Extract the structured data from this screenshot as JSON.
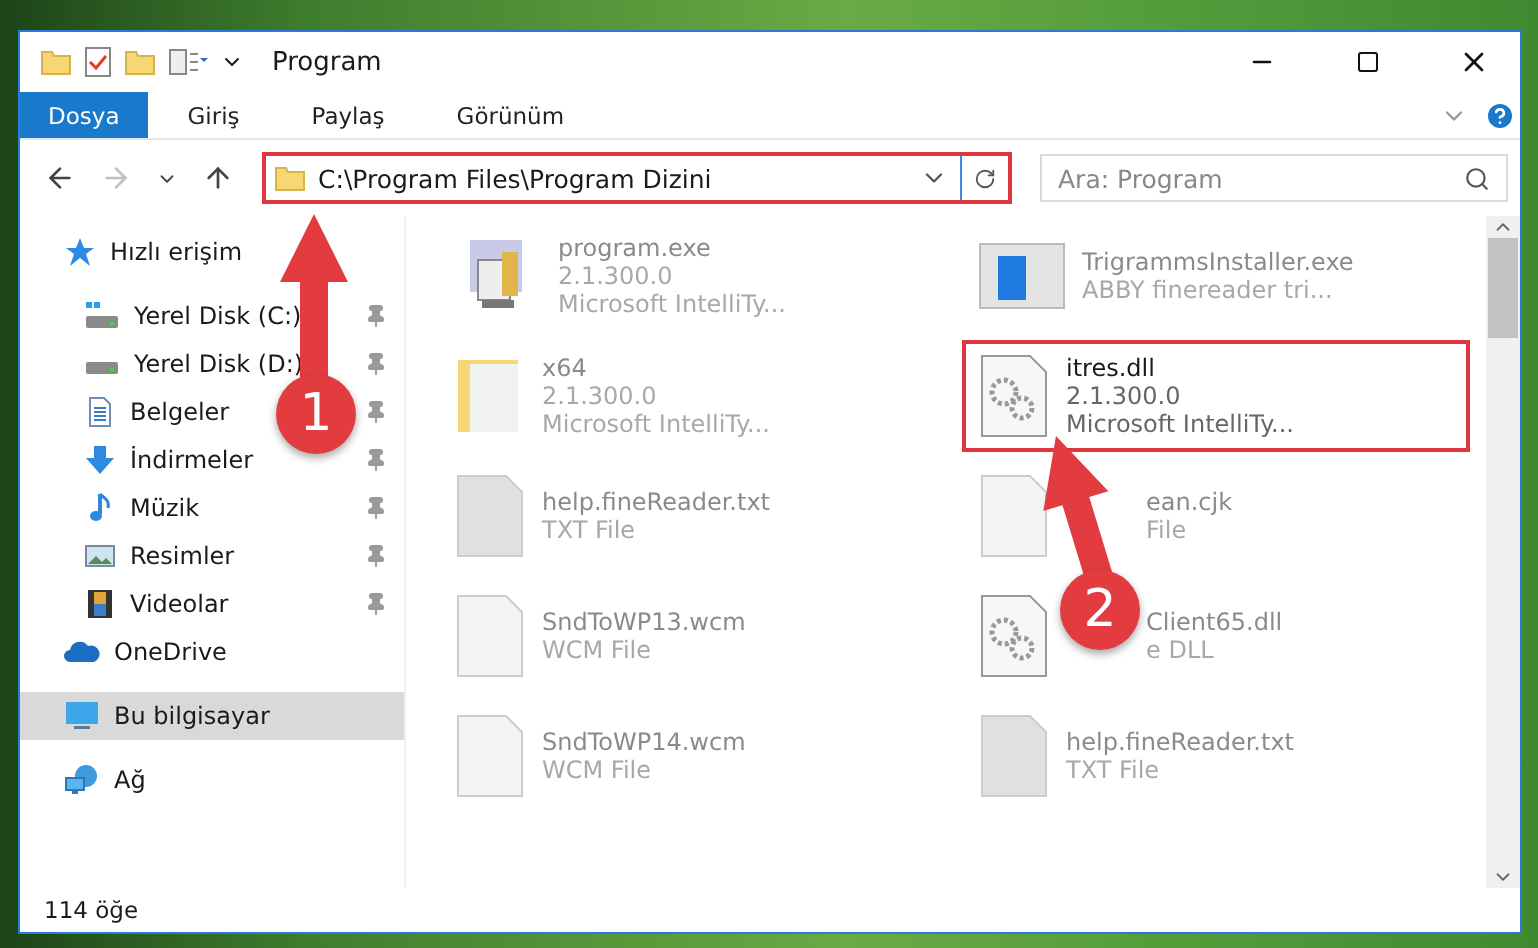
{
  "window": {
    "title": "Program"
  },
  "ribbon_tabs": [
    {
      "label": "Dosya",
      "selected": true
    },
    {
      "label": "Giriş",
      "selected": false
    },
    {
      "label": "Paylaş",
      "selected": false
    },
    {
      "label": "Görünüm",
      "selected": false
    }
  ],
  "address": {
    "path": "C:\\Program Files\\Program Dizini",
    "highlighted": true
  },
  "search": {
    "placeholder": "Ara: Program"
  },
  "nav": [
    {
      "label": "Hızlı erişim",
      "kind": "star",
      "selected": false,
      "children": [
        {
          "label": "Yerel Disk (C:)",
          "kind": "system-drive",
          "pinned": true,
          "selected": false
        },
        {
          "label": "Yerel Disk (D:)",
          "kind": "drive",
          "pinned": true,
          "selected": false
        },
        {
          "label": "Belgeler",
          "kind": "documents",
          "pinned": true,
          "selected": false
        },
        {
          "label": "İndirmeler",
          "kind": "download",
          "pinned": true,
          "selected": false
        },
        {
          "label": "Müzik",
          "kind": "music",
          "pinned": true,
          "selected": false
        },
        {
          "label": "Resimler",
          "kind": "pictures",
          "pinned": true,
          "selected": false
        },
        {
          "label": "Videolar",
          "kind": "videos",
          "pinned": true,
          "selected": false
        }
      ]
    },
    {
      "label": "OneDrive",
      "kind": "cloud",
      "selected": false
    },
    {
      "label": "Bu bilgisayar",
      "kind": "computer",
      "selected": true
    },
    {
      "label": "Ağ",
      "kind": "network",
      "selected": false
    }
  ],
  "files": [
    {
      "name": "program.exe",
      "details": [
        "2.1.300.0",
        "Microsoft IntelliTy..."
      ],
      "kind": "app",
      "highlighted": false,
      "partly_hidden": false
    },
    {
      "name": "TrigrammsInstaller.exe",
      "details": [
        "ABBY finereader tri..."
      ],
      "kind": "installer",
      "highlighted": false,
      "partly_hidden": false
    },
    {
      "name": "x64",
      "details": [
        "2.1.300.0",
        "Microsoft IntelliTy..."
      ],
      "kind": "folder",
      "highlighted": false,
      "partly_hidden": false
    },
    {
      "name": "itres.dll",
      "details": [
        "2.1.300.0",
        "Microsoft IntelliTy..."
      ],
      "kind": "dll",
      "highlighted": true,
      "partly_hidden": false
    },
    {
      "name": "help.fineReader.txt",
      "details": [
        "TXT File"
      ],
      "kind": "text",
      "highlighted": false,
      "partly_hidden": false
    },
    {
      "name": "ean.cjk",
      "details": [
        "File"
      ],
      "kind": "blank",
      "highlighted": false,
      "partly_hidden": true
    },
    {
      "name": "SndToWP13.wcm",
      "details": [
        "WCM File"
      ],
      "kind": "blank",
      "highlighted": false,
      "partly_hidden": false
    },
    {
      "name": "Client65.dll",
      "details": [
        "e DLL"
      ],
      "kind": "dll",
      "highlighted": false,
      "partly_hidden": true
    },
    {
      "name": "SndToWP14.wcm",
      "details": [
        "WCM File"
      ],
      "kind": "blank",
      "highlighted": false,
      "partly_hidden": false
    },
    {
      "name": "help.fineReader.txt",
      "details": [
        "TXT File"
      ],
      "kind": "text",
      "highlighted": false,
      "partly_hidden": false
    }
  ],
  "status_bar": {
    "count": "114 öğe"
  },
  "callouts": [
    {
      "number": "1"
    },
    {
      "number": "2"
    }
  ]
}
